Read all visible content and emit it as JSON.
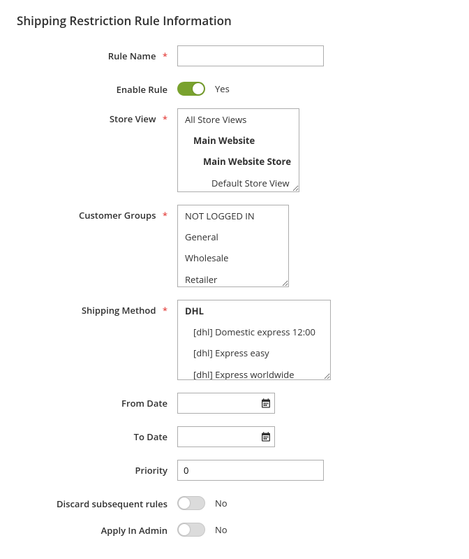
{
  "section_title": "Shipping Restriction Rule Information",
  "fields": {
    "rule_name": {
      "label": "Rule Name",
      "required": true,
      "value": ""
    },
    "enable_rule": {
      "label": "Enable Rule",
      "value_text": "Yes",
      "on": true
    },
    "store_view": {
      "label": "Store View",
      "required": true,
      "options": [
        {
          "text": "All Store Views",
          "indent": 0,
          "bold": false
        },
        {
          "text": "Main Website",
          "indent": 1,
          "bold": true
        },
        {
          "text": "Main Website Store",
          "indent": 2,
          "bold": true
        },
        {
          "text": "Default Store View",
          "indent": 3,
          "bold": false
        }
      ]
    },
    "customer_groups": {
      "label": "Customer Groups",
      "required": true,
      "options": [
        {
          "text": "NOT LOGGED IN"
        },
        {
          "text": "General"
        },
        {
          "text": "Wholesale"
        },
        {
          "text": "Retailer"
        }
      ]
    },
    "shipping_method": {
      "label": "Shipping Method",
      "required": true,
      "options": [
        {
          "text": "DHL",
          "bold": true,
          "indent": 0
        },
        {
          "text": "[dhl] Domestic express 12:00",
          "indent": 1
        },
        {
          "text": "[dhl] Express easy",
          "indent": 1
        },
        {
          "text": "[dhl] Express worldwide",
          "indent": 1
        }
      ]
    },
    "from_date": {
      "label": "From Date",
      "value": ""
    },
    "to_date": {
      "label": "To Date",
      "value": ""
    },
    "priority": {
      "label": "Priority",
      "value": "0"
    },
    "discard": {
      "label": "Discard subsequent rules",
      "value_text": "No",
      "on": false
    },
    "apply_admin": {
      "label": "Apply In Admin",
      "value_text": "No",
      "on": false
    }
  },
  "required_marker": "*"
}
